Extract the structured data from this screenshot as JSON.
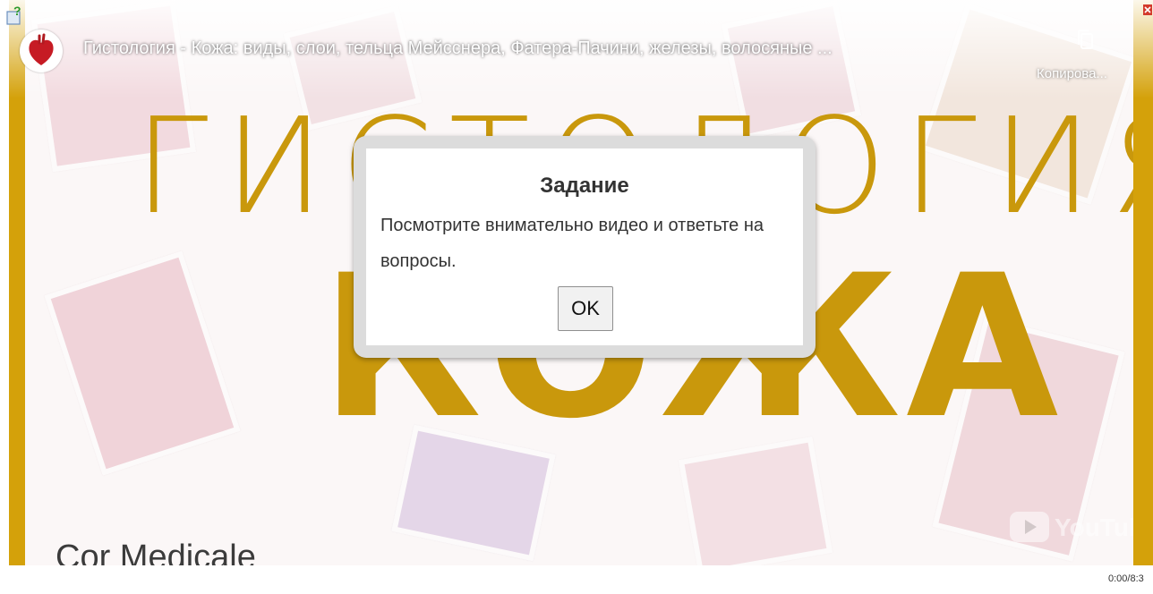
{
  "video": {
    "title": "Гистология - Кожа: виды, слои, тельца Мейсснера, Фатера-Пачини, железы, волосяные ...",
    "copy_label": "Копирова...",
    "thumbnail_title": "ГИСТОЛОГИЯ",
    "thumbnail_subtitle": "КОЖА",
    "brand": "Cor Medicale",
    "youtube_label": "YouTube",
    "time": "0:00/8:3"
  },
  "dialog": {
    "title": "Задание",
    "text": "Посмотрите внимательно видео и ответьте на вопросы.",
    "ok_label": "OK"
  },
  "colors": {
    "accent_gold": "#d4a10a",
    "title_gold": "#c9980c",
    "dialog_frame": "#dcdcdc",
    "text": "#333333"
  }
}
